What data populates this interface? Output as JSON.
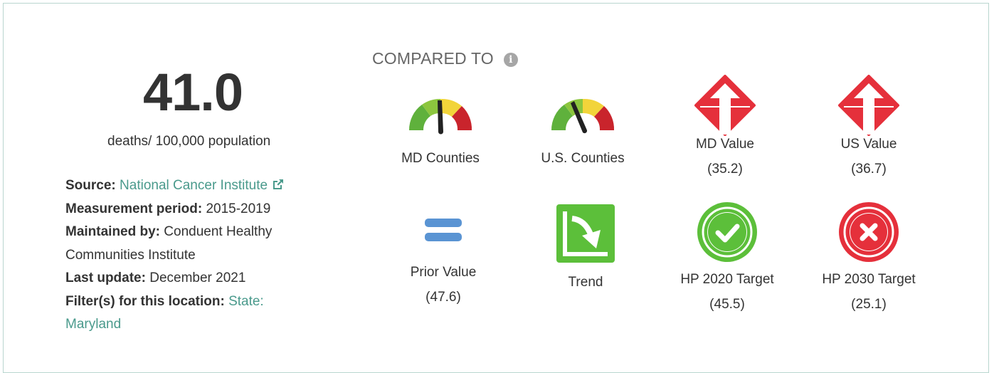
{
  "indicator": {
    "value": "41.0",
    "unit": "deaths/ 100,000 population"
  },
  "meta": {
    "source_label": "Source:",
    "source_value": "National Cancer Institute",
    "period_label": "Measurement period:",
    "period_value": "2015-2019",
    "maintained_label": "Maintained by:",
    "maintained_value": "Conduent Healthy Communities Institute",
    "update_label": "Last update:",
    "update_value": "December 2021",
    "filter_label": "Filter(s) for this location:",
    "filter_value": "State: Maryland"
  },
  "compared": {
    "title": "COMPARED TO",
    "items": [
      {
        "label": "MD Counties",
        "value": "",
        "icon": "gauge-icon"
      },
      {
        "label": "U.S. Counties",
        "value": "",
        "icon": "gauge-icon"
      },
      {
        "label": "MD Value",
        "value": "(35.2)",
        "icon": "red-up-arrow-icon"
      },
      {
        "label": "US Value",
        "value": "(36.7)",
        "icon": "red-up-arrow-icon"
      },
      {
        "label": "Prior Value",
        "value": "(47.6)",
        "icon": "equal-icon"
      },
      {
        "label": "Trend",
        "value": "",
        "icon": "trend-down-icon"
      },
      {
        "label": "HP 2020 Target",
        "value": "(45.5)",
        "icon": "green-check-icon"
      },
      {
        "label": "HP 2030 Target",
        "value": "(25.1)",
        "icon": "red-x-icon"
      }
    ]
  },
  "colors": {
    "link": "#4a9a8c",
    "red": "#e5303b",
    "green": "#5cbf3a",
    "blue": "#5a94d3"
  }
}
